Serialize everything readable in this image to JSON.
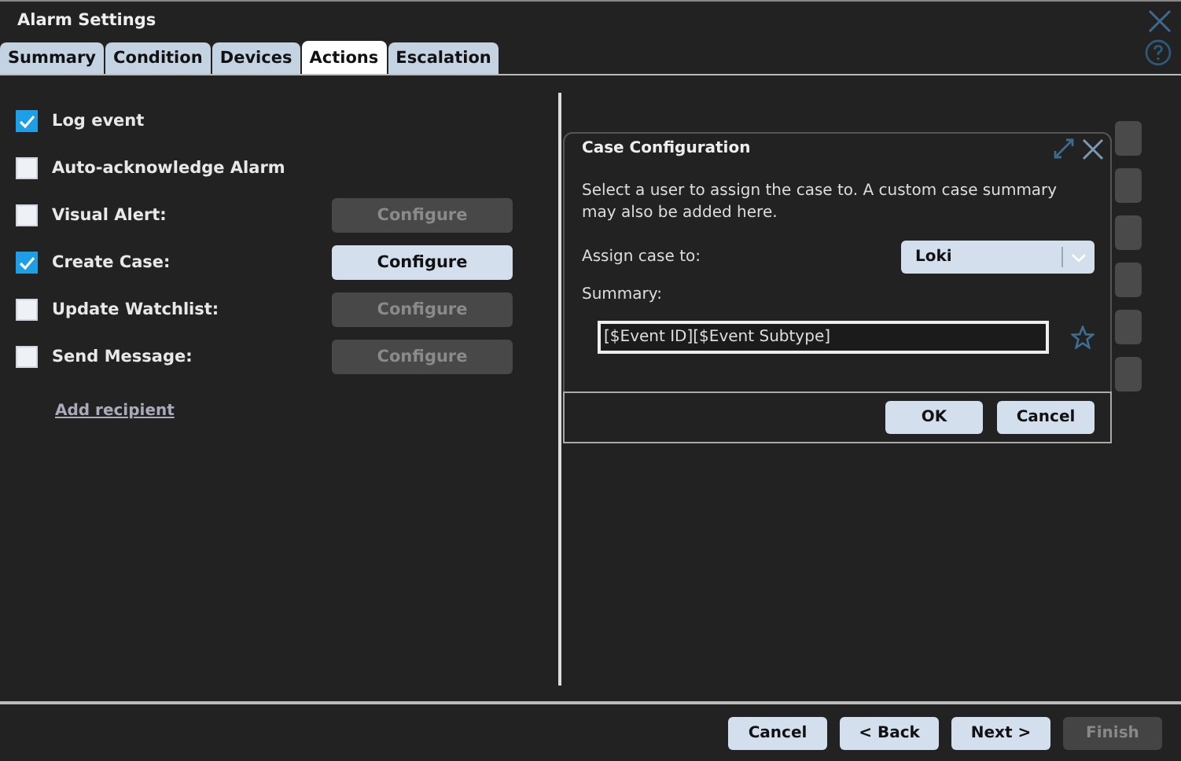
{
  "window": {
    "title": "Alarm Settings"
  },
  "tabs": [
    {
      "label": "Summary",
      "selected": false
    },
    {
      "label": "Condition",
      "selected": false
    },
    {
      "label": "Devices",
      "selected": false
    },
    {
      "label": "Actions",
      "selected": true
    },
    {
      "label": "Escalation",
      "selected": false
    }
  ],
  "actions": [
    {
      "kind": "plain",
      "label": "Log event",
      "checked": true
    },
    {
      "kind": "plain",
      "label": "Auto-acknowledge Alarm",
      "checked": false
    },
    {
      "kind": "configurable",
      "label": "Visual Alert:",
      "checked": false,
      "button": {
        "label": "Configure",
        "disabled": true
      }
    },
    {
      "kind": "configurable",
      "label": "Create Case:",
      "checked": true,
      "button": {
        "label": "Configure",
        "disabled": false
      }
    },
    {
      "kind": "configurable",
      "label": "Update Watchlist:",
      "checked": false,
      "button": {
        "label": "Configure",
        "disabled": true
      }
    },
    {
      "kind": "configurable",
      "label": "Send Message:",
      "checked": false,
      "button": {
        "label": "Configure",
        "disabled": true
      }
    }
  ],
  "add_recipient": "Add recipient",
  "case_dialog": {
    "title": "Case Configuration",
    "description": "Select a user to assign the case to. A custom case summary may also be added here.",
    "assign_label": "Assign case to:",
    "assignee": "Loki",
    "summary_label": "Summary:",
    "summary_value": "[$Event ID][$Event Subtype]",
    "buttons": [
      {
        "label": "OK"
      },
      {
        "label": "Cancel"
      }
    ]
  },
  "footer_buttons": [
    {
      "label": "Cancel",
      "disabled": false
    },
    {
      "label": "< Back",
      "disabled": false
    },
    {
      "label": "Next >",
      "disabled": false
    },
    {
      "label": "Finish",
      "disabled": true
    }
  ]
}
